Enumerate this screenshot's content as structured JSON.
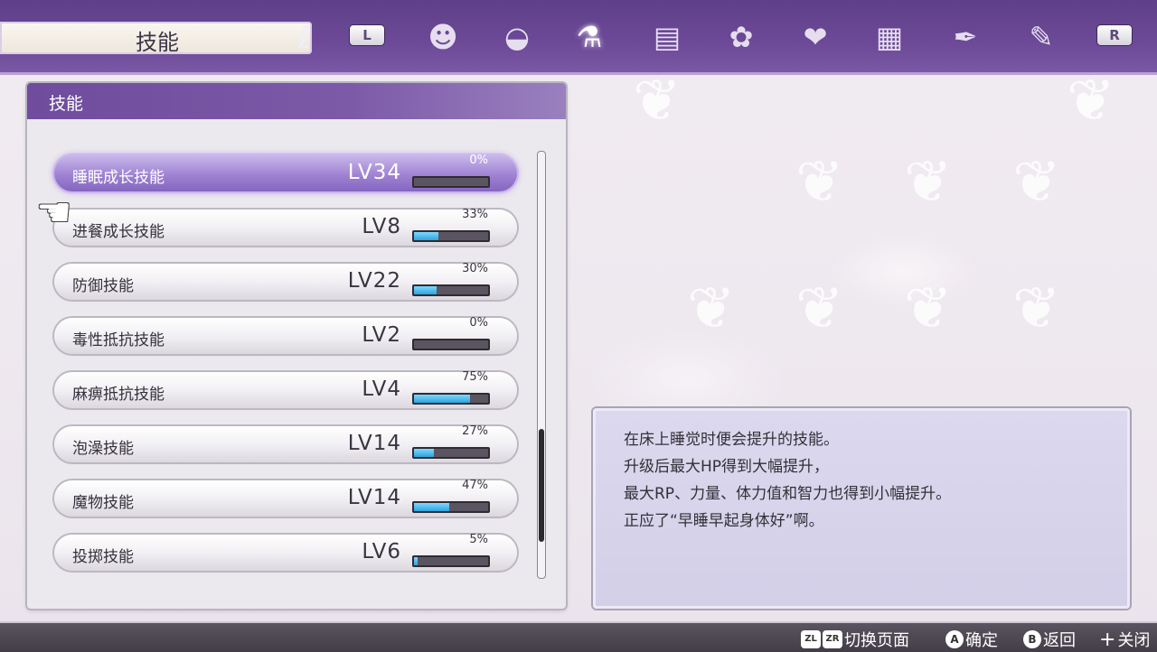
{
  "header": {
    "title": "技能",
    "left_shoulder": "L",
    "right_shoulder": "R",
    "tabs": [
      {
        "name": "farmer-face-icon",
        "glyph": "☻"
      },
      {
        "name": "pouch-icon",
        "glyph": "◒"
      },
      {
        "name": "skills-icon",
        "glyph": "⚗",
        "active": true
      },
      {
        "name": "notebook-icon",
        "glyph": "▤"
      },
      {
        "name": "monsters-icon",
        "glyph": "✿"
      },
      {
        "name": "friendship-icon",
        "glyph": "❤"
      },
      {
        "name": "recipe-card-icon",
        "glyph": "▦"
      },
      {
        "name": "quill-icon",
        "glyph": "✒"
      },
      {
        "name": "settings-wrench-icon",
        "glyph": "✎"
      }
    ]
  },
  "panel": {
    "title": "技能",
    "skills": [
      {
        "name": "睡眠成长技能",
        "level": "LV34",
        "percent": "0%",
        "progress": 0
      },
      {
        "name": "进餐成长技能",
        "level": "LV8",
        "percent": "33%",
        "progress": 33
      },
      {
        "name": "防御技能",
        "level": "LV22",
        "percent": "30%",
        "progress": 30
      },
      {
        "name": "毒性抵抗技能",
        "level": "LV2",
        "percent": "0%",
        "progress": 0
      },
      {
        "name": "麻痹抵抗技能",
        "level": "LV4",
        "percent": "75%",
        "progress": 75
      },
      {
        "name": "泡澡技能",
        "level": "LV14",
        "percent": "27%",
        "progress": 27
      },
      {
        "name": "魔物技能",
        "level": "LV14",
        "percent": "47%",
        "progress": 47
      },
      {
        "name": "投掷技能",
        "level": "LV6",
        "percent": "5%",
        "progress": 5
      }
    ],
    "selected_index": 0
  },
  "description": {
    "lines": [
      "在床上睡觉时便会提升的技能。",
      "升级后最大HP得到大幅提升，",
      "最大RP、力量、体力值和智力也得到小幅提升。",
      "正应了“早睡早起身体好”啊。"
    ]
  },
  "footer": {
    "zl": "ZL",
    "zr": "ZR",
    "switch_page": "切换页面",
    "a_btn": "A",
    "confirm": "确定",
    "b_btn": "B",
    "back": "返回",
    "plus_btn": "+",
    "close": "关闭"
  },
  "colors": {
    "header_purple": "#6d4a98",
    "selected_row": "#9f82d3",
    "progress_fill": "#2ca4dd"
  }
}
